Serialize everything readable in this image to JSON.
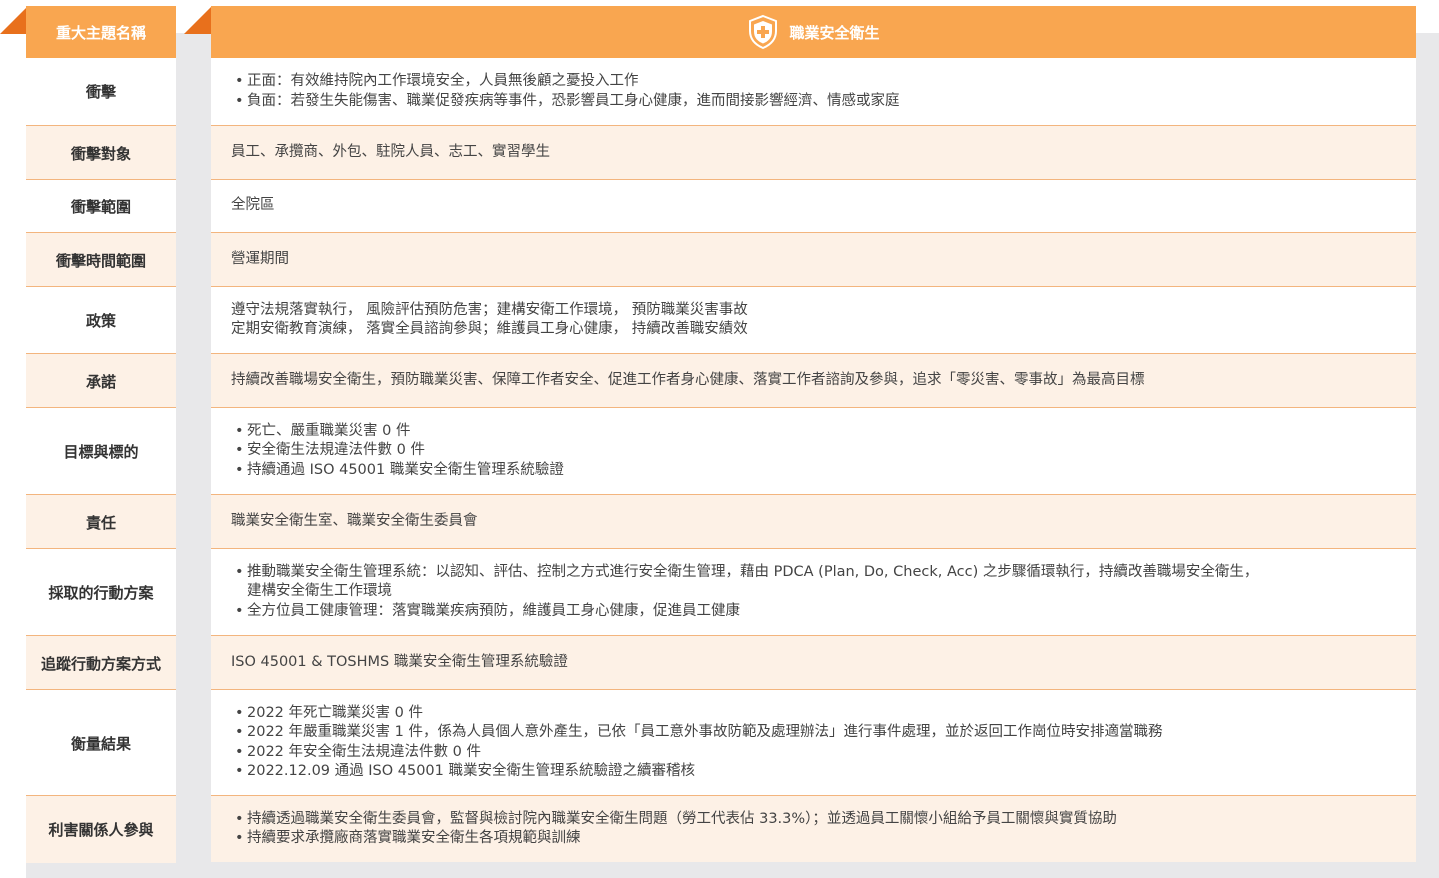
{
  "header": {
    "left_title": "重大主題名稱",
    "right_title": "職業安全衛生",
    "icon": "shield-cross-icon",
    "accent_color": "#f9a650"
  },
  "rows": [
    {
      "label": "衝擊",
      "bullets": [
        "正面：有效維持院內工作環境安全，人員無後顧之憂投入工作",
        "負面：若發生失能傷害、職業促發疾病等事件，恐影響員工身心健康，進而間接影響經濟、情感或家庭"
      ]
    },
    {
      "label": "衝擊對象",
      "lines": [
        "員工、承攬商、外包、駐院人員、志工、實習學生"
      ]
    },
    {
      "label": "衝擊範圍",
      "lines": [
        "全院區"
      ]
    },
    {
      "label": "衝擊時間範圍",
      "lines": [
        "營運期間"
      ]
    },
    {
      "label": "政策",
      "lines": [
        "遵守法規落實執行， 風險評估預防危害；建構安衛工作環境， 預防職業災害事故",
        "定期安衛教育演練， 落實全員諮詢參與；維護員工身心健康， 持續改善職安績效"
      ]
    },
    {
      "label": "承諾",
      "lines": [
        "持續改善職場安全衛生，預防職業災害、保障工作者安全、促進工作者身心健康、落實工作者諮詢及參與，追求「零災害、零事故」為最高目標"
      ]
    },
    {
      "label": "目標與標的",
      "bullets": [
        "死亡、嚴重職業災害 0 件",
        "安全衛生法規違法件數 0 件",
        "持續通過 ISO 45001 職業安全衛生管理系統驗證"
      ]
    },
    {
      "label": "責任",
      "lines": [
        "職業安全衛生室、職業安全衛生委員會"
      ]
    },
    {
      "label": "採取的行動方案",
      "bullets": [
        "推動職業安全衛生管理系統：以認知、評估、控制之方式進行安全衛生管理，藉由 PDCA (Plan, Do, Check, Acc) 之步驟循環執行，持續改善職場安全衛生，",
        "全方位員工健康管理：落實職業疾病預防，維護員工身心健康，促進員工健康"
      ],
      "continuation": "建構安全衛生工作環境"
    },
    {
      "label": "追蹤行動方案方式",
      "lines": [
        "ISO 45001 & TOSHMS 職業安全衛生管理系統驗證"
      ]
    },
    {
      "label": "衡量結果",
      "bullets": [
        "2022 年死亡職業災害 0 件",
        "2022 年嚴重職業災害 1 件，係為人員個人意外產生，已依「員工意外事故防範及處理辦法」進行事件處理，並於返回工作崗位時安排適當職務",
        "2022 年安全衛生法規違法件數 0 件",
        "2022.12.09 通過 ISO 45001 職業安全衛生管理系統驗證之續審稽核"
      ]
    },
    {
      "label": "利害關係人參與",
      "bullets": [
        "持續透過職業安全衛生委員會，監督與檢討院內職業安全衛生問題（勞工代表佔 33.3%）；並透過員工關懷小組給予員工關懷與實質協助",
        "持續要求承攬廠商落實職業安全衛生各項規範與訓練"
      ]
    }
  ]
}
